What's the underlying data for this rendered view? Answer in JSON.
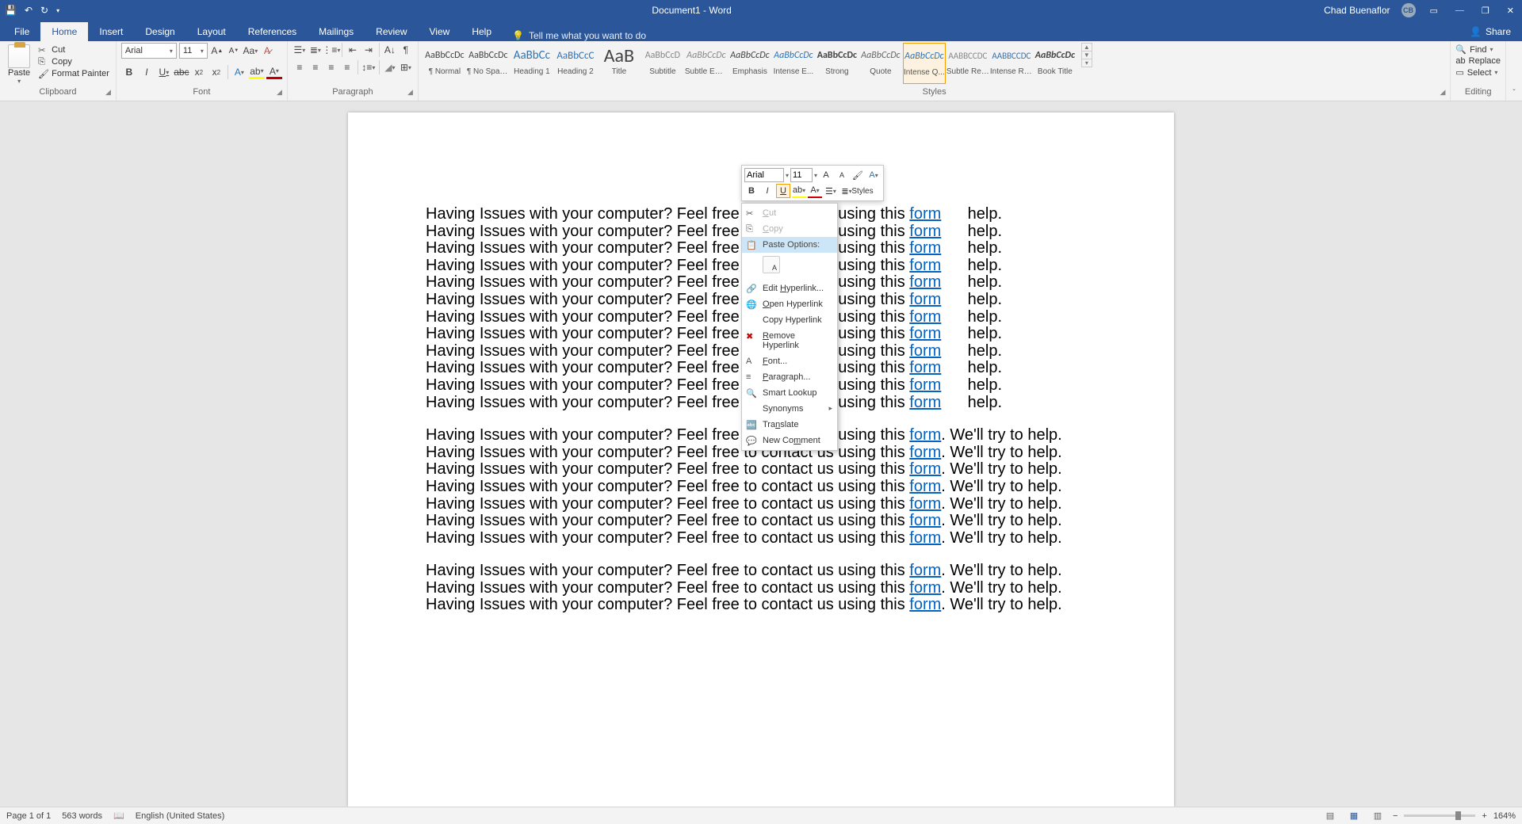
{
  "title": "Document1 - Word",
  "user": {
    "name": "Chad Buenaflor",
    "initials": "CB"
  },
  "tabs": [
    "File",
    "Home",
    "Insert",
    "Design",
    "Layout",
    "References",
    "Mailings",
    "Review",
    "View",
    "Help"
  ],
  "active_tab": "Home",
  "tellme": "Tell me what you want to do",
  "share": "Share",
  "clipboard": {
    "label": "Clipboard",
    "paste": "Paste",
    "cut": "Cut",
    "copy": "Copy",
    "format_painter": "Format Painter"
  },
  "font": {
    "label": "Font",
    "name": "Arial",
    "size": "11"
  },
  "paragraph": {
    "label": "Paragraph"
  },
  "styles": {
    "label": "Styles",
    "items": [
      {
        "name": "¶ Normal",
        "preview": "AaBbCcDc",
        "size": 12
      },
      {
        "name": "¶ No Spac...",
        "preview": "AaBbCcDc",
        "size": 12
      },
      {
        "name": "Heading 1",
        "preview": "AaBbCc",
        "size": 15,
        "color": "#2e74b5"
      },
      {
        "name": "Heading 2",
        "preview": "AaBbCcC",
        "size": 13,
        "color": "#2e74b5"
      },
      {
        "name": "Title",
        "preview": "AaB",
        "size": 24
      },
      {
        "name": "Subtitle",
        "preview": "AaBbCcD",
        "size": 12,
        "color": "#888"
      },
      {
        "name": "Subtle Em...",
        "preview": "AaBbCcDc",
        "size": 12,
        "italic": true,
        "color": "#888"
      },
      {
        "name": "Emphasis",
        "preview": "AaBbCcDc",
        "size": 12,
        "italic": true
      },
      {
        "name": "Intense E...",
        "preview": "AaBbCcDc",
        "size": 12,
        "italic": true,
        "color": "#2e74b5"
      },
      {
        "name": "Strong",
        "preview": "AaBbCcDc",
        "size": 12,
        "bold": true
      },
      {
        "name": "Quote",
        "preview": "AaBbCcDc",
        "size": 12,
        "italic": true,
        "color": "#666"
      },
      {
        "name": "Intense Q...",
        "preview": "AaBbCcDc",
        "size": 12,
        "italic": true,
        "color": "#2e74b5"
      },
      {
        "name": "Subtle Ref...",
        "preview": "AABBCCDC",
        "size": 11,
        "color": "#888"
      },
      {
        "name": "Intense Re...",
        "preview": "AABBCCDC",
        "size": 11,
        "color": "#2e74b5"
      },
      {
        "name": "Book Title",
        "preview": "AaBbCcDc",
        "size": 12,
        "bold": true,
        "italic": true
      }
    ],
    "selected": 11
  },
  "editing": {
    "label": "Editing",
    "find": "Find",
    "replace": "Replace",
    "select": "Select"
  },
  "mini_toolbar": {
    "font": "Arial",
    "size": "11",
    "styles": "Styles"
  },
  "context_menu": {
    "cut": "Cut",
    "copy": "Copy",
    "paste_options": "Paste Options:",
    "edit_hyperlink": "Edit Hyperlink...",
    "open_hyperlink": "Open Hyperlink",
    "copy_hyperlink": "Copy Hyperlink",
    "remove_hyperlink": "Remove Hyperlink",
    "font": "Font...",
    "paragraph": "Paragraph...",
    "smart_lookup": "Smart Lookup",
    "synonyms": "Synonyms",
    "translate": "Translate",
    "new_comment": "New Comment"
  },
  "document": {
    "line_prefix": "Having Issues with your computer? Feel free to contact us using this ",
    "link_text": "form",
    "line_suffix_full": ". We'll try to help.",
    "line_suffix_truncated": "help.",
    "block1_count": 12,
    "block2_count": 7,
    "block3_count": 3
  },
  "status": {
    "page": "Page 1 of 1",
    "words": "563 words",
    "lang": "English (United States)",
    "zoom": "164%"
  }
}
